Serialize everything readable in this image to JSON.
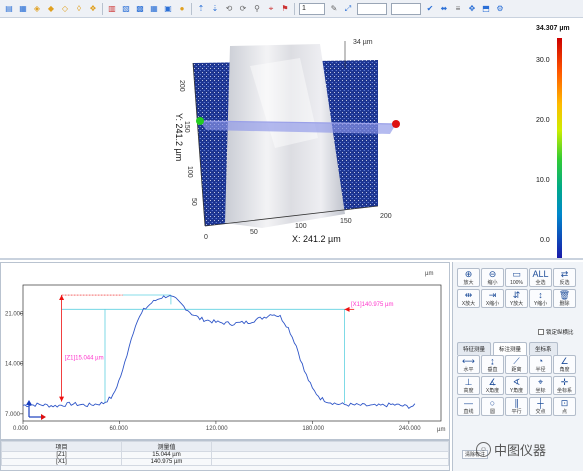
{
  "toolbar": {
    "page_select": "1",
    "icons": [
      "open-icon",
      "save-icon",
      "cube-icon",
      "cube-top-icon",
      "cube-front-icon",
      "cube-side-icon",
      "cube-iso-icon",
      "color-map-icon",
      "profile-icon",
      "table-icon",
      "grid-icon",
      "image-icon",
      "circle-icon",
      "arrow-up-icon",
      "arrow-down-icon",
      "rotate-icon",
      "reset-icon",
      "zoom-icon",
      "crosshair-icon",
      "flag-icon",
      "wrench-icon",
      "tilt-icon",
      "check-icon",
      "level-icon",
      "lines-icon",
      "move-icon",
      "layers-icon",
      "settings-icon"
    ]
  },
  "view3d": {
    "z_peak_label": "34 µm",
    "y_axis_title": "Y: 241.2 µm",
    "x_axis_title": "X: 241.2 µm",
    "x_ticks": [
      "0",
      "50",
      "100",
      "150",
      "200"
    ],
    "y_ticks": [
      "200",
      "150",
      "100",
      "50"
    ],
    "colorbar": {
      "max_label": "34.307 µm",
      "ticks": [
        "30.0",
        "20.0",
        "10.0",
        "0.0"
      ],
      "colors": [
        "#cc0000",
        "#ff4400",
        "#ff9900",
        "#ffee00",
        "#66dd00",
        "#00bb55",
        "#00aaaa",
        "#0055dd",
        "#1a1aaa"
      ]
    }
  },
  "profile": {
    "unit": "µm",
    "x_ticks": [
      "0.000",
      "60.000",
      "120.000",
      "180.000",
      "240.000"
    ],
    "y_ticks": [
      "21.000",
      "14.000",
      "7.000"
    ],
    "annotations": {
      "z1": "[Z1]15.044 µm",
      "x1": "[X1]140.975 µm"
    },
    "colors": {
      "profile_line": "#2f56c8",
      "annotation": "#ff33cc",
      "guide": "#5fd0e0",
      "arrow": "#ee1111"
    }
  },
  "chart_data": {
    "type": "line",
    "xlabel": "",
    "ylabel": "",
    "xlim": [
      0,
      260
    ],
    "ylim": [
      6,
      25
    ],
    "series": [
      {
        "x": [
          0,
          10,
          20,
          30,
          40,
          50,
          56,
          62,
          66,
          70,
          75,
          80,
          85,
          90,
          95,
          100,
          105,
          110,
          120,
          130,
          140,
          150,
          155,
          160,
          165,
          170,
          175,
          180,
          185,
          190,
          195,
          200,
          210,
          220,
          230,
          240,
          245
        ],
        "y": [
          8.2,
          8.3,
          8.1,
          8.4,
          8.2,
          8.5,
          9.5,
          13.0,
          16.5,
          19.5,
          21.5,
          22.5,
          23.2,
          23.5,
          23.0,
          22.0,
          21.0,
          20.3,
          19.8,
          19.6,
          19.8,
          20.5,
          21.0,
          20.6,
          19.0,
          16.5,
          13.0,
          10.5,
          9.2,
          8.7,
          8.4,
          8.3,
          8.2,
          8.1,
          8.3,
          8.0,
          8.2
        ]
      }
    ]
  },
  "measurements": {
    "headers": [
      "项目",
      "测量值"
    ],
    "rows": [
      [
        "[Z1]",
        "15.044 µm"
      ],
      [
        "[X1]",
        "140.975 µm"
      ]
    ]
  },
  "tools": {
    "top_buttons": [
      {
        "icon": "zoom-in-icon",
        "glyph": "⊕",
        "label": "放大"
      },
      {
        "icon": "zoom-out-icon",
        "glyph": "⊖",
        "label": "缩小"
      },
      {
        "icon": "fit-100-icon",
        "glyph": "▭",
        "label": "100%"
      },
      {
        "icon": "fit-all-icon",
        "glyph": "ALL",
        "label": "全选"
      },
      {
        "icon": "reverse-icon",
        "glyph": "⇄",
        "label": "反选"
      },
      {
        "icon": "x-zoom-in-icon",
        "glyph": "⇹",
        "label": "X放大"
      },
      {
        "icon": "x-zoom-out-icon",
        "glyph": "⇥",
        "label": "X缩小"
      },
      {
        "icon": "y-zoom-in-icon",
        "glyph": "⇵",
        "label": "Y放大"
      },
      {
        "icon": "y-zoom-out-icon",
        "glyph": "↕",
        "label": "Y缩小"
      },
      {
        "icon": "delete-icon",
        "glyph": "🗑",
        "label": "删除"
      }
    ],
    "lock_label": "锁定纵横比",
    "tabs": [
      "特征测量",
      "标注测量",
      "坐标系"
    ],
    "measure_buttons": [
      {
        "icon": "horizontal-icon",
        "glyph": "⟷",
        "label": "水平"
      },
      {
        "icon": "vertical-icon",
        "glyph": "↨",
        "label": "垂直"
      },
      {
        "icon": "distance-icon",
        "glyph": "⟋",
        "label": "距离"
      },
      {
        "icon": "radius-icon",
        "glyph": "◔",
        "label": "半径"
      },
      {
        "icon": "angle-icon",
        "glyph": "∠",
        "label": "角度"
      },
      {
        "icon": "height-icon",
        "glyph": "⊥",
        "label": "高度"
      },
      {
        "icon": "x-angle-icon",
        "glyph": "∡",
        "label": "X角度"
      },
      {
        "icon": "y-angle-icon",
        "glyph": "∢",
        "label": "Y角度"
      },
      {
        "icon": "coordinate-icon",
        "glyph": "⌖",
        "label": "坐标"
      },
      {
        "icon": "coordinate-xy-icon",
        "glyph": "✛",
        "label": "坐标系"
      },
      {
        "icon": "line-icon",
        "glyph": "—",
        "label": "直线"
      },
      {
        "icon": "circle-icon",
        "glyph": "○",
        "label": "圆"
      },
      {
        "icon": "parallel-icon",
        "glyph": "∥",
        "label": "平行"
      },
      {
        "icon": "cross-icon",
        "glyph": "┼",
        "label": "交点"
      },
      {
        "icon": "point-icon",
        "glyph": "⊡",
        "label": "点"
      }
    ],
    "bottom_button": "清除标注",
    "watermark": "中图仪器"
  }
}
